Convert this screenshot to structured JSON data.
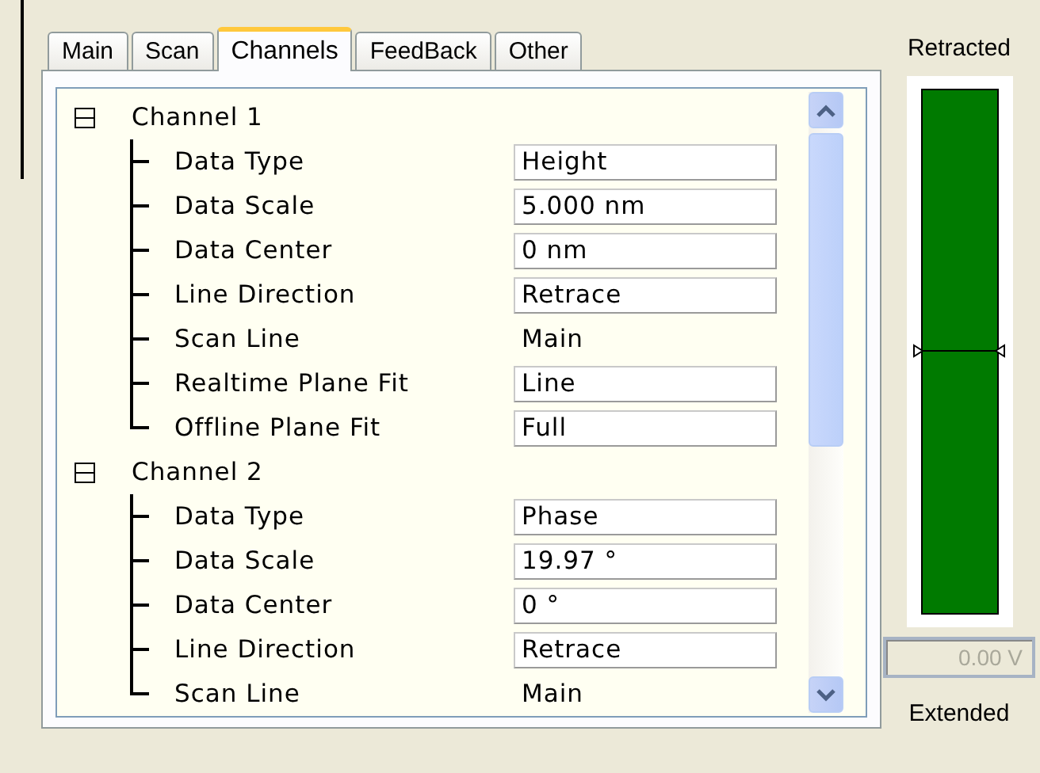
{
  "tabs": [
    {
      "label": "Main",
      "selected": false
    },
    {
      "label": "Scan",
      "selected": false
    },
    {
      "label": "Channels",
      "selected": true
    },
    {
      "label": "FeedBack",
      "selected": false
    },
    {
      "label": "Other",
      "selected": false
    }
  ],
  "tree": [
    {
      "label": "Channel 1",
      "expanded": true,
      "children": [
        {
          "label": "Data Type",
          "kind": "field",
          "value": "Height"
        },
        {
          "label": "Data Scale",
          "kind": "field",
          "value": "5.000 nm"
        },
        {
          "label": "Data Center",
          "kind": "field",
          "value": "0 nm"
        },
        {
          "label": "Line Direction",
          "kind": "field",
          "value": "Retrace"
        },
        {
          "label": "Scan Line",
          "kind": "text",
          "value": "Main"
        },
        {
          "label": "Realtime Plane Fit",
          "kind": "field",
          "value": "Line"
        },
        {
          "label": "Offline Plane Fit",
          "kind": "field",
          "value": "Full"
        }
      ]
    },
    {
      "label": "Channel 2",
      "expanded": true,
      "children": [
        {
          "label": "Data Type",
          "kind": "field",
          "value": "Phase"
        },
        {
          "label": "Data Scale",
          "kind": "field",
          "value": "19.97 °"
        },
        {
          "label": "Data Center",
          "kind": "field",
          "value": "0 °"
        },
        {
          "label": "Line Direction",
          "kind": "field",
          "value": "Retrace"
        },
        {
          "label": "Scan Line",
          "kind": "text",
          "value": "Main"
        }
      ]
    }
  ],
  "gauge": {
    "top_label": "Retracted",
    "level": 0.5,
    "reading": "0.00 V",
    "reading_disabled": true,
    "bottom_label": "Extended"
  }
}
